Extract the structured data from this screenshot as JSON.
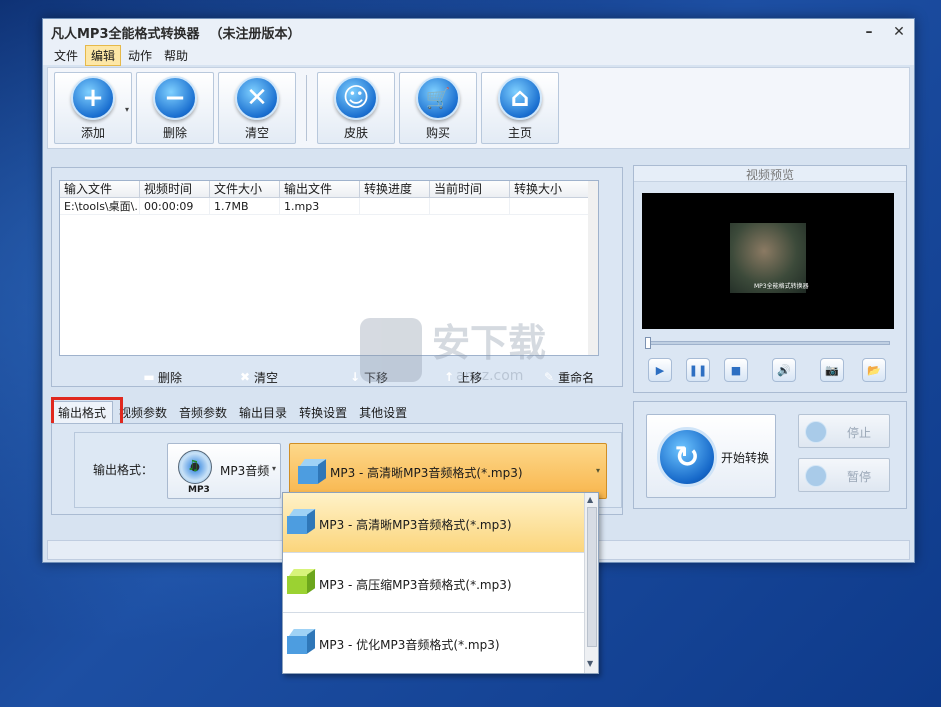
{
  "window": {
    "title": "凡人MP3全能格式转换器",
    "subtitle": "（未注册版本）",
    "min": "–",
    "close": "✕"
  },
  "menu": [
    "文件",
    "编辑",
    "动作",
    "帮助"
  ],
  "toolbar": {
    "buttons": [
      {
        "label": "添加",
        "glyph": "+",
        "icon": "add-icon"
      },
      {
        "label": "删除",
        "glyph": "−",
        "icon": "remove-icon"
      },
      {
        "label": "清空",
        "glyph": "✕",
        "icon": "clear-icon"
      },
      {
        "label": "皮肤",
        "glyph": "☺",
        "icon": "skin-icon"
      },
      {
        "label": "购买",
        "glyph": "🛒",
        "icon": "cart-icon"
      },
      {
        "label": "主页",
        "glyph": "⌂",
        "icon": "home-icon"
      }
    ],
    "dropdown_glyph": "▾"
  },
  "file_table": {
    "columns": [
      "输入文件",
      "视频时间",
      "文件大小",
      "输出文件",
      "转换进度",
      "当前时间",
      "转换大小"
    ],
    "rows": [
      [
        "E:\\tools\\桌面\\...",
        "00:00:09",
        "1.7MB",
        "1.mp3",
        "",
        "",
        ""
      ]
    ]
  },
  "list_actions": [
    {
      "label": "删除",
      "glyph": "▬"
    },
    {
      "label": "清空",
      "glyph": "✖"
    },
    {
      "label": "下移",
      "glyph": "↓"
    },
    {
      "label": "上移",
      "glyph": "↑"
    },
    {
      "label": "重命名",
      "glyph": "✎"
    }
  ],
  "tabs": [
    "输出格式",
    "视频参数",
    "音频参数",
    "输出目录",
    "转换设置",
    "其他设置"
  ],
  "format": {
    "label": "输出格式：",
    "type_name": "MP3音频",
    "type_sub": "MP3",
    "selected": "MP3 - 高清晰MP3音频格式(*.mp3)",
    "options": [
      "MP3 - 高清晰MP3音频格式(*.mp3)",
      "MP3 - 高压缩MP3音频格式(*.mp3)",
      "MP3 - 优化MP3音频格式(*.mp3)"
    ]
  },
  "preview": {
    "title": "视频预览",
    "caption": "MP3全能格式转换器",
    "progress": 0,
    "controls": [
      {
        "name": "play-button",
        "glyph": "▶"
      },
      {
        "name": "pause-button",
        "glyph": "❚❚"
      },
      {
        "name": "stop-button",
        "glyph": "■"
      },
      {
        "name": "volume-button",
        "glyph": "🔊"
      },
      {
        "name": "snapshot-button",
        "glyph": "📷"
      },
      {
        "name": "open-folder-button",
        "glyph": "📂"
      }
    ]
  },
  "convert": {
    "start": "开始转换",
    "stop": "停止",
    "pause": "暂停"
  },
  "watermark": {
    "big": "安下载",
    "small": "anxz.com"
  },
  "colors": {
    "accent": "#1a6fd0",
    "selected_item": "#fbd57c",
    "highlight_box": "#e0281e"
  }
}
